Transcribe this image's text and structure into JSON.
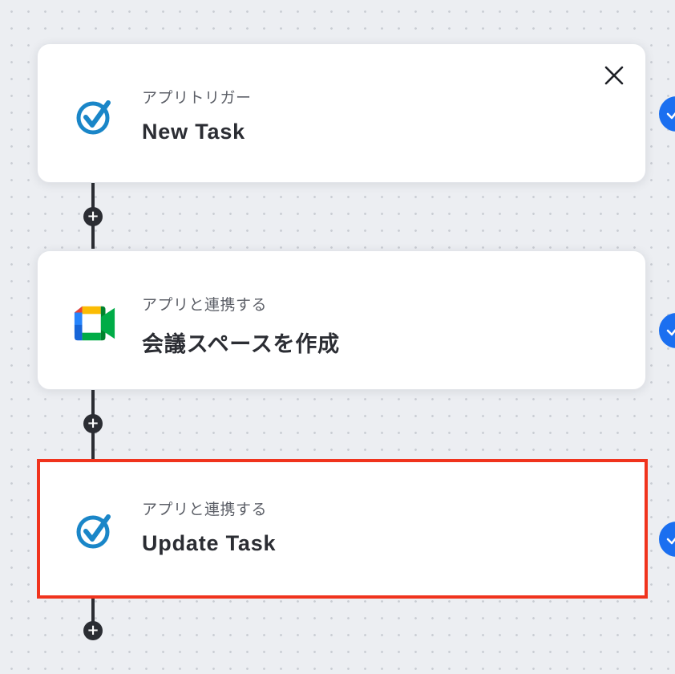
{
  "workflow": {
    "steps": [
      {
        "category": "アプリトリガー",
        "title": "New Task",
        "icon": "check-task-icon",
        "selected": false,
        "has_close": true
      },
      {
        "category": "アプリと連携する",
        "title": "会議スペースを作成",
        "icon": "google-meet-icon",
        "selected": false,
        "has_close": false
      },
      {
        "category": "アプリと連携する",
        "title": "Update Task",
        "icon": "check-task-icon",
        "selected": true,
        "has_close": false
      }
    ],
    "add_step_glyph": "+",
    "colors": {
      "accent": "#1b6ff0",
      "selection_border": "#f0331d",
      "connector": "#2b2d33",
      "task_icon": "#1a86c8"
    }
  }
}
